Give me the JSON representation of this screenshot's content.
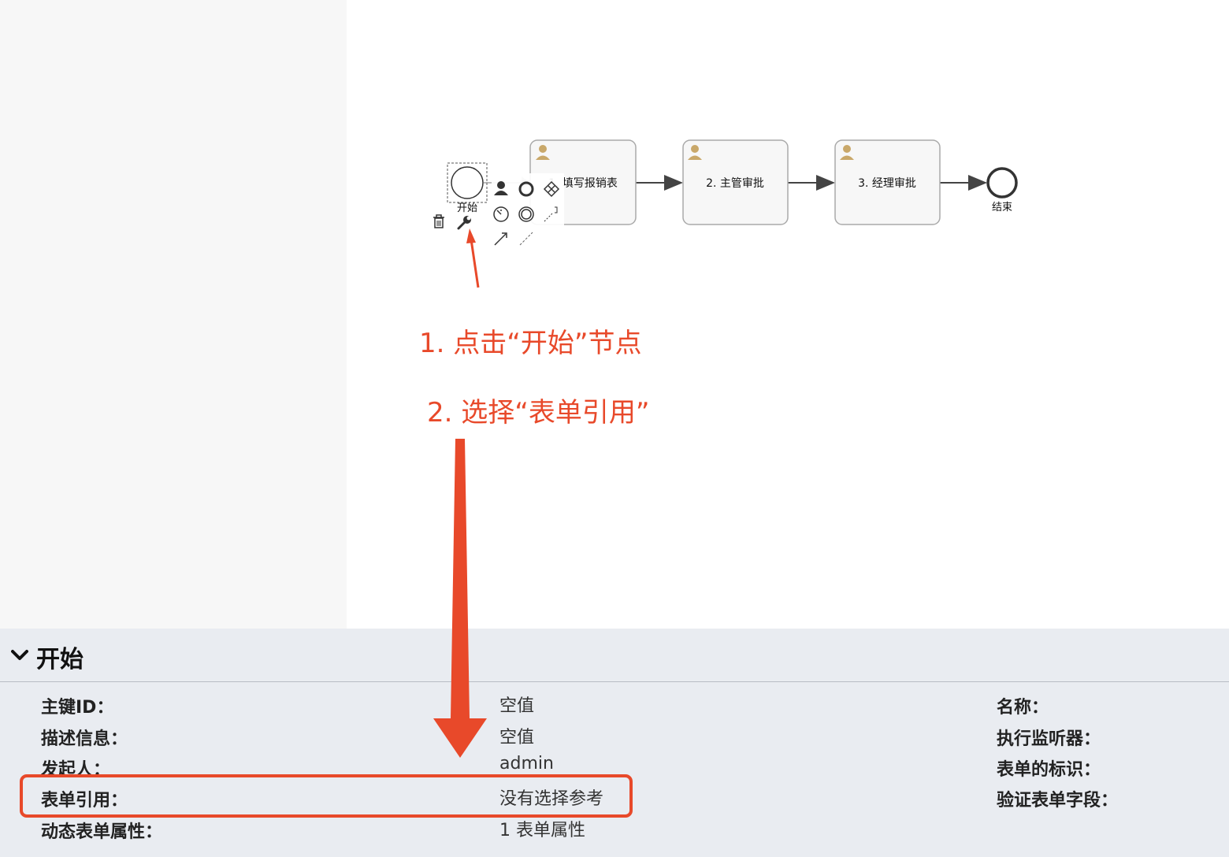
{
  "diagram": {
    "start_label": "开始",
    "tasks": [
      {
        "label": "1. 填写报销表"
      },
      {
        "label": "2. 主管审批"
      },
      {
        "label": "3. 经理审批"
      }
    ],
    "end_label": "结束"
  },
  "annotations": {
    "step1": "1. 点击“开始”节点",
    "step2": "2. 选择“表单引用”"
  },
  "colors": {
    "annotation": "#e8492a",
    "panel_bg": "#e9ecf1",
    "user_icon": "#c9a86a"
  },
  "properties": {
    "title": "开始",
    "rows": [
      {
        "label": "主键ID：",
        "value": "空值"
      },
      {
        "label": "描述信息：",
        "value": "空值"
      },
      {
        "label": "发起人：",
        "value": "admin"
      },
      {
        "label": "表单引用：",
        "value": "没有选择参考"
      },
      {
        "label": "动态表单属性：",
        "value": "1 表单属性"
      }
    ],
    "right_labels": [
      "名称：",
      "执行监听器：",
      "表单的标识：",
      "验证表单字段："
    ]
  }
}
